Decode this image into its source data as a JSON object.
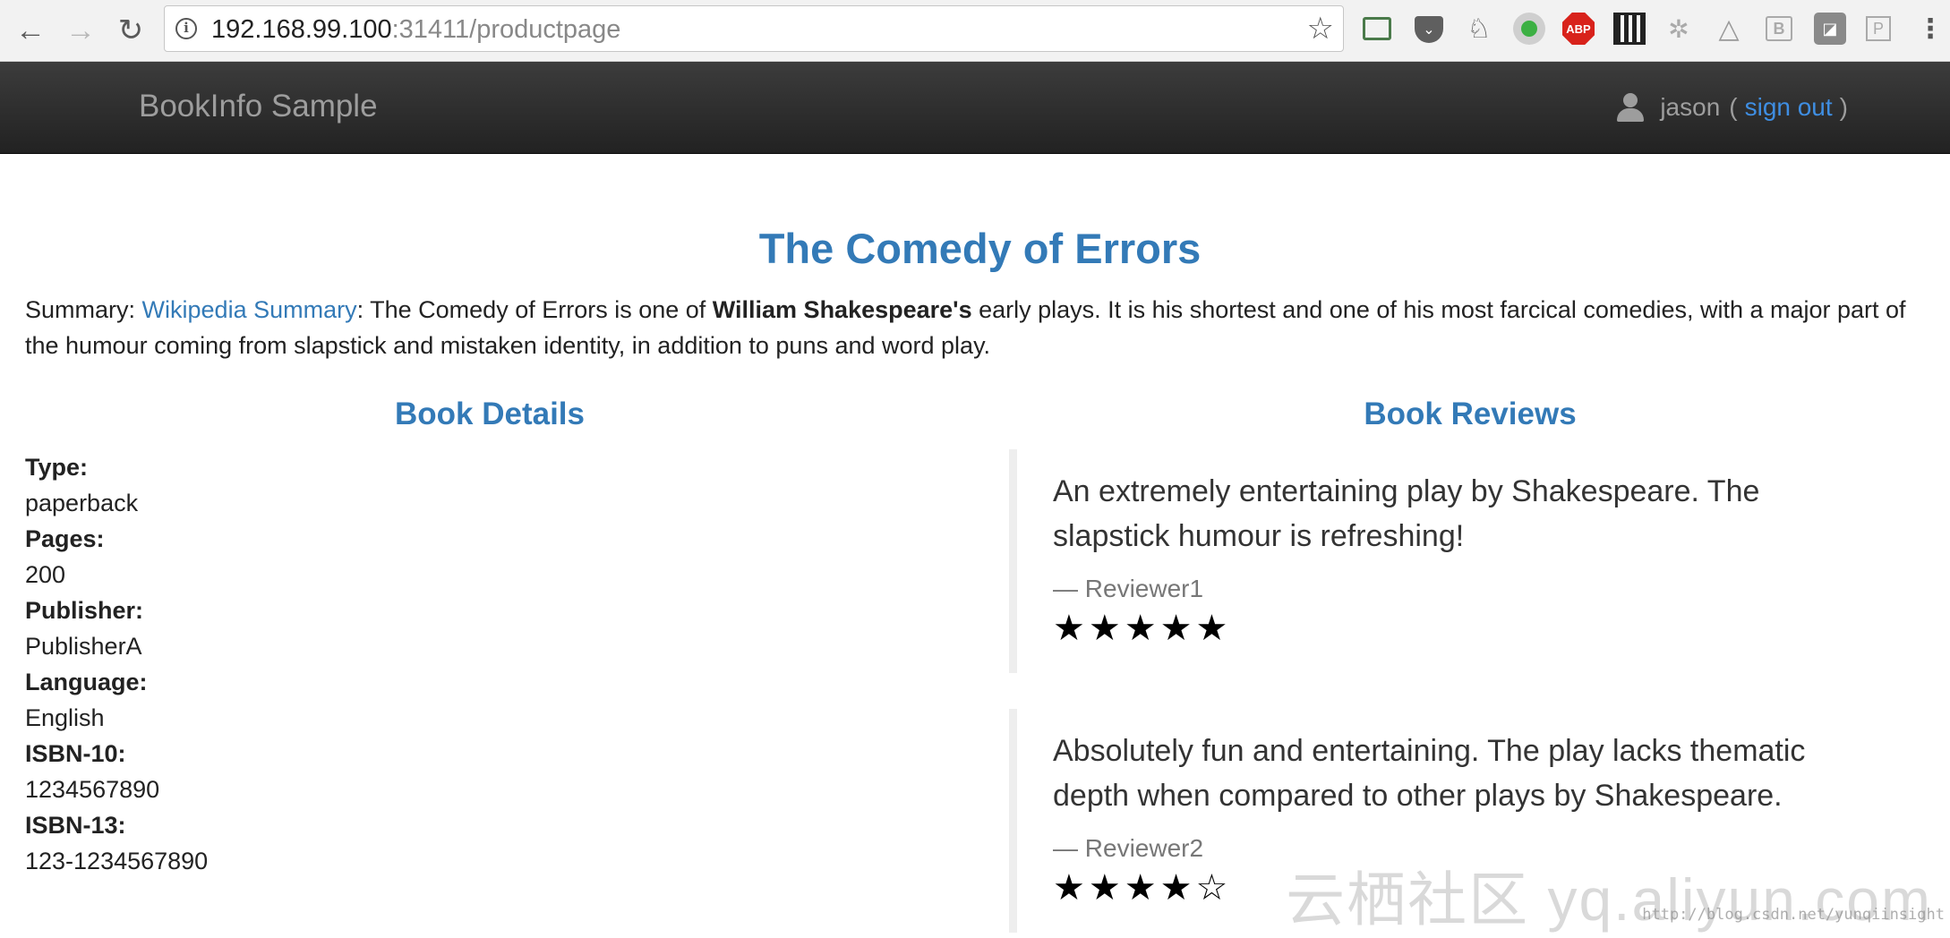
{
  "browser": {
    "back_icon": "←",
    "forward_icon": "→",
    "reload_icon": "↻",
    "address": {
      "host": "192.168.99.100",
      "path": ":31411/productpage"
    },
    "star_icon": "☆",
    "info_icon": "i",
    "extensions": [
      "cast-icon",
      "pocket-icon",
      "evernote-icon",
      "green-dot-icon",
      "abp-icon",
      "qr-code-icon",
      "puzzle-icon",
      "drive-icon",
      "b-icon",
      "note-icon",
      "p-icon",
      "menu-icon"
    ],
    "abp_label": "ABP",
    "menu_icon": "⋮"
  },
  "navbar": {
    "brand": "BookInfo Sample",
    "user": "jason",
    "open_paren": "(",
    "sign_out": "sign out",
    "close_paren": ")"
  },
  "page": {
    "title": "The Comedy of Errors",
    "summary": {
      "label": "Summary:",
      "link": "Wikipedia Summary",
      "text_before_bold": ": The Comedy of Errors is one of ",
      "bold": "William Shakespeare's",
      "text_after_bold": " early plays. It is his shortest and one of his most farcical comedies, with a major part of the humour coming from slapstick and mistaken identity, in addition to puns and word play."
    }
  },
  "details": {
    "heading": "Book Details",
    "items": [
      {
        "label": "Type:",
        "value": "paperback"
      },
      {
        "label": "Pages:",
        "value": "200"
      },
      {
        "label": "Publisher:",
        "value": "PublisherA"
      },
      {
        "label": "Language:",
        "value": "English"
      },
      {
        "label": "ISBN-10:",
        "value": "1234567890"
      },
      {
        "label": "ISBN-13:",
        "value": "123-1234567890"
      }
    ]
  },
  "reviews": {
    "heading": "Book Reviews",
    "items": [
      {
        "text": "An extremely entertaining play by Shakespeare. The slapstick humour is refreshing!",
        "author": "— Reviewer1",
        "rating": 5,
        "max_rating": 5,
        "stars": "★★★★★"
      },
      {
        "text": "Absolutely fun and entertaining. The play lacks thematic depth when compared to other plays by Shakespeare.",
        "author": "— Reviewer2",
        "rating": 4,
        "max_rating": 5,
        "stars": "★★★★☆"
      }
    ]
  },
  "watermark": {
    "main": "云栖社区 yq.aliyun.com",
    "small": "http://blog.csdn.net/yunqiinsight"
  },
  "colors": {
    "link": "#337ab7",
    "navbar_bg": "#222222",
    "navbar_text": "#9d9d9d",
    "sign_out_link": "#3f8ee2"
  }
}
